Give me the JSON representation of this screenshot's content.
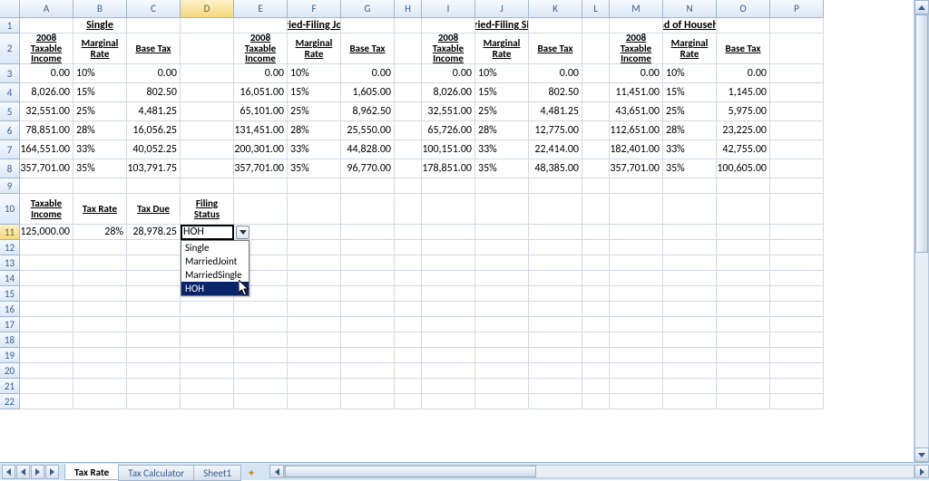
{
  "columns": [
    "A",
    "B",
    "C",
    "D",
    "E",
    "F",
    "G",
    "H",
    "I",
    "J",
    "K",
    "L",
    "M",
    "N",
    "O",
    "P"
  ],
  "row_count": 22,
  "selected_cell": "D11",
  "group_titles": {
    "single": "Single",
    "mfj": "Married-Filing Jointly",
    "mfs": "Married-Filing Single",
    "hoh": "Head of Household"
  },
  "col_headers": {
    "income": "2008 Taxable Income",
    "rate": "Marginal Rate",
    "base": "Base Tax"
  },
  "table": {
    "single": [
      {
        "income": "0.00",
        "rate": "10%",
        "base": "0.00"
      },
      {
        "income": "8,026.00",
        "rate": "15%",
        "base": "802.50"
      },
      {
        "income": "32,551.00",
        "rate": "25%",
        "base": "4,481.25"
      },
      {
        "income": "78,851.00",
        "rate": "28%",
        "base": "16,056.25"
      },
      {
        "income": "164,551.00",
        "rate": "33%",
        "base": "40,052.25"
      },
      {
        "income": "357,701.00",
        "rate": "35%",
        "base": "103,791.75"
      }
    ],
    "mfj": [
      {
        "income": "0.00",
        "rate": "10%",
        "base": "0.00"
      },
      {
        "income": "16,051.00",
        "rate": "15%",
        "base": "1,605.00"
      },
      {
        "income": "65,101.00",
        "rate": "25%",
        "base": "8,962.50"
      },
      {
        "income": "131,451.00",
        "rate": "28%",
        "base": "25,550.00"
      },
      {
        "income": "200,301.00",
        "rate": "33%",
        "base": "44,828.00"
      },
      {
        "income": "357,701.00",
        "rate": "35%",
        "base": "96,770.00"
      }
    ],
    "mfs": [
      {
        "income": "0.00",
        "rate": "10%",
        "base": "0.00"
      },
      {
        "income": "8,026.00",
        "rate": "15%",
        "base": "802.50"
      },
      {
        "income": "32,551.00",
        "rate": "25%",
        "base": "4,481.25"
      },
      {
        "income": "65,726.00",
        "rate": "28%",
        "base": "12,775.00"
      },
      {
        "income": "100,151.00",
        "rate": "33%",
        "base": "22,414.00"
      },
      {
        "income": "178,851.00",
        "rate": "35%",
        "base": "48,385.00"
      }
    ],
    "hoh": [
      {
        "income": "0.00",
        "rate": "10%",
        "base": "0.00"
      },
      {
        "income": "11,451.00",
        "rate": "15%",
        "base": "1,145.00"
      },
      {
        "income": "43,651.00",
        "rate": "25%",
        "base": "5,975.00"
      },
      {
        "income": "112,651.00",
        "rate": "28%",
        "base": "23,225.00"
      },
      {
        "income": "182,401.00",
        "rate": "33%",
        "base": "42,755.00"
      },
      {
        "income": "357,701.00",
        "rate": "35%",
        "base": "100,605.00"
      }
    ]
  },
  "calc_headers": {
    "taxable_income": "Taxable Income",
    "tax_rate": "Tax Rate",
    "tax_due": "Tax Due",
    "filing_status": "Filing Status"
  },
  "calc_row": {
    "taxable_income": "125,000.00",
    "tax_rate": "28%",
    "tax_due": "28,978.25",
    "filing_status": "HOH"
  },
  "dropdown": {
    "options": [
      "Single",
      "MarriedJoint",
      "MarriedSingle",
      "HOH"
    ],
    "selected": "HOH"
  },
  "tabs": {
    "active": "Tax Rate",
    "others": [
      "Tax Calculator",
      "Sheet1"
    ]
  }
}
